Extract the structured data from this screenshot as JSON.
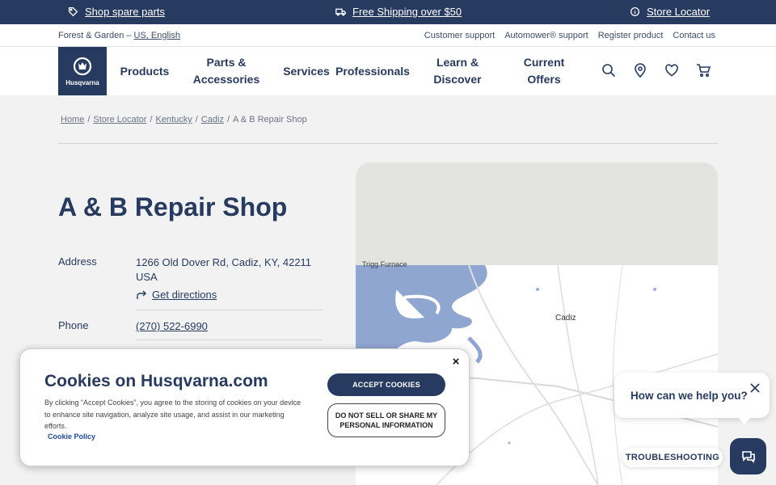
{
  "promo": {
    "spare_parts": "Shop spare parts",
    "shipping": "Free Shipping over $50",
    "store_locator": "Store Locator"
  },
  "util": {
    "segment": "Forest & Garden –",
    "language": "US, English",
    "links": [
      "Customer support",
      "Automower® support",
      "Register product",
      "Contact us"
    ]
  },
  "brand": {
    "logo_text": "Husqvarna",
    "color": "#273a60"
  },
  "nav": {
    "products": "Products",
    "parts_1": "Parts &",
    "parts_2": "Accessories",
    "services": "Services",
    "professionals": "Professionals",
    "learn_1": "Learn &",
    "learn_2": "Discover",
    "offers_1": "Current",
    "offers_2": "Offers",
    "icons": [
      "search-icon",
      "location-pin-icon",
      "heart-icon",
      "cart-icon"
    ]
  },
  "breadcrumb": {
    "items": [
      "Home",
      "Store Locator",
      "Kentucky",
      "Cadiz"
    ],
    "current": "A & B Repair Shop"
  },
  "store": {
    "name": "A & B Repair Shop",
    "address_label": "Address",
    "address_line1": "1266 Old Dover Rd, Cadiz, KY, 42211",
    "address_line2": "USA",
    "directions": "Get directions",
    "phone_label": "Phone",
    "phone": "(270) 522-6990"
  },
  "map": {
    "town": "Cadiz",
    "place_partial": "Trigg Furnace"
  },
  "cookie": {
    "title": "Cookies on Husqvarna.com",
    "description": "By clicking “Accept Cookies”, you agree to the storing of cookies on your device to enhance site navigation, analyze site usage, and assist in our marketing efforts.",
    "policy": "Cookie Policy",
    "accept": "ACCEPT COOKIES",
    "do_not_sell_1": "DO NOT SELL OR SHARE MY",
    "do_not_sell_2": "PERSONAL INFORMATION",
    "close": "×"
  },
  "chat": {
    "question": "How can we help you?",
    "troubleshooting": "TROUBLESHOOTING"
  }
}
